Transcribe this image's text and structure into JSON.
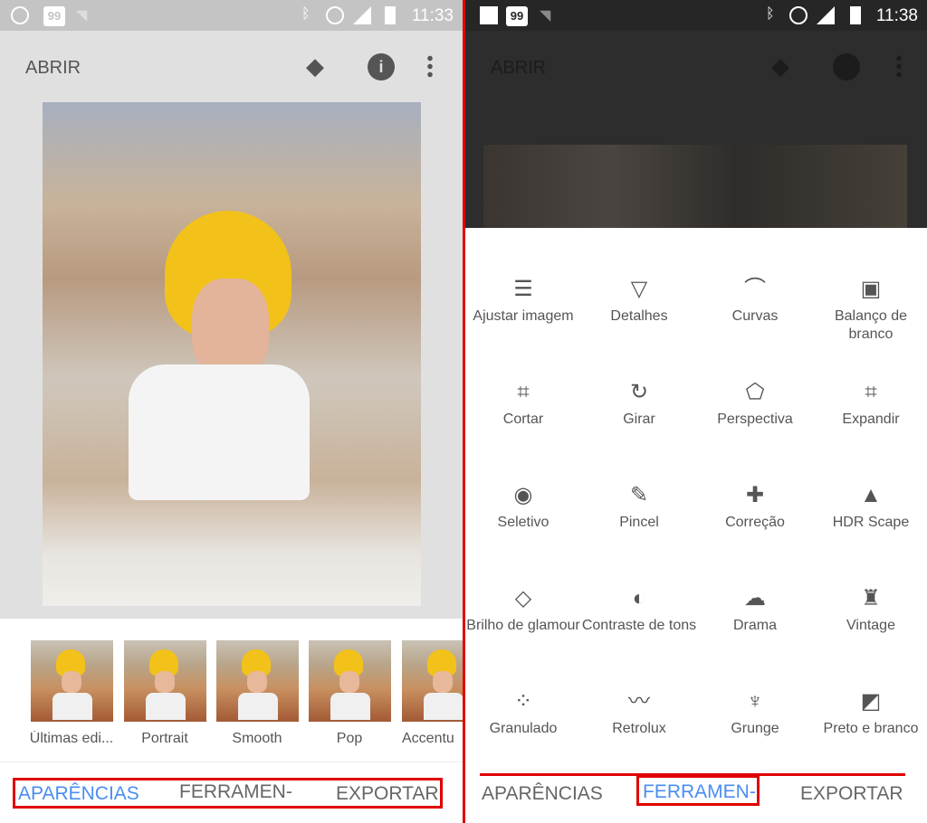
{
  "left": {
    "status": {
      "time": "11:33",
      "icons": [
        "whatsapp-icon",
        "99-app-icon",
        "wifi-unknown-icon",
        "bluetooth-icon",
        "alarm-icon",
        "4g-signal-icon",
        "battery-icon"
      ],
      "app_badge": "99"
    },
    "appbar": {
      "title": "ABRIR",
      "icons": [
        "undo-stack-icon",
        "info-icon",
        "more-vert-icon"
      ]
    },
    "looks": [
      {
        "label": "Últimas edi..."
      },
      {
        "label": "Portrait"
      },
      {
        "label": "Smooth"
      },
      {
        "label": "Pop"
      },
      {
        "label": "Accentu"
      }
    ],
    "tabs": [
      {
        "label": "APARÊNCIAS",
        "active": true
      },
      {
        "label": "FERRAMEN-",
        "active": false
      },
      {
        "label": "EXPORTAR",
        "active": false
      }
    ]
  },
  "right": {
    "status": {
      "time": "11:38",
      "icons": [
        "image-icon",
        "99-app-icon",
        "wifi-unknown-icon",
        "bluetooth-icon",
        "alarm-icon",
        "4g-signal-icon",
        "battery-icon"
      ],
      "app_badge": "99"
    },
    "appbar": {
      "title": "ABRIR"
    },
    "tools": [
      {
        "label": "Ajustar imagem",
        "icon": "sliders-icon"
      },
      {
        "label": "Detalhes",
        "icon": "triangle-icon"
      },
      {
        "label": "Curvas",
        "icon": "curves-icon"
      },
      {
        "label": "Balanço de branco",
        "icon": "white-balance-icon"
      },
      {
        "label": "Cortar",
        "icon": "crop-icon"
      },
      {
        "label": "Girar",
        "icon": "rotate-icon"
      },
      {
        "label": "Perspectiva",
        "icon": "perspective-icon"
      },
      {
        "label": "Expandir",
        "icon": "expand-icon"
      },
      {
        "label": "Seletivo",
        "icon": "selective-icon"
      },
      {
        "label": "Pincel",
        "icon": "brush-icon"
      },
      {
        "label": "Correção",
        "icon": "healing-icon"
      },
      {
        "label": "HDR Scape",
        "icon": "mountains-icon"
      },
      {
        "label": "Brilho de glamour",
        "icon": "diamond-icon"
      },
      {
        "label": "Contraste de tons",
        "icon": "tonal-contrast-icon"
      },
      {
        "label": "Drama",
        "icon": "cloud-icon"
      },
      {
        "label": "Vintage",
        "icon": "lamp-icon"
      },
      {
        "label": "Granulado",
        "icon": "grain-icon"
      },
      {
        "label": "Retrolux",
        "icon": "mustache-icon"
      },
      {
        "label": "Grunge",
        "icon": "guitar-icon"
      },
      {
        "label": "Preto e branco",
        "icon": "black-white-icon"
      }
    ],
    "tabs": [
      {
        "label": "APARÊNCIAS",
        "active": false
      },
      {
        "label": "FERRAMEN-",
        "active": true
      },
      {
        "label": "EXPORTAR",
        "active": false
      }
    ]
  },
  "colors": {
    "accent": "#4a8df0",
    "highlight": "#e00000"
  }
}
